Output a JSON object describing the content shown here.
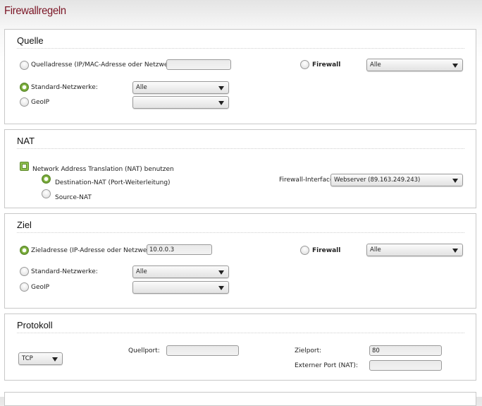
{
  "page": {
    "title": "Firewallregeln"
  },
  "quelle": {
    "title": "Quelle",
    "address_label": "Quelladresse (IP/MAC-Adresse oder Netzwerk):",
    "address_value": "",
    "address_selected": false,
    "firewall_label": "Firewall",
    "firewall_selected": false,
    "firewall_select": "Alle",
    "standard_label": "Standard-Netzwerke:",
    "standard_selected": true,
    "standard_select": "Alle",
    "geoip_label": "GeoIP",
    "geoip_selected": false,
    "geoip_select": ""
  },
  "nat": {
    "title": "NAT",
    "use_nat_label": "Network Address Translation (NAT) benutzen",
    "use_nat_checked": true,
    "dnat_label": "Destination-NAT (Port-Weiterleitung)",
    "dnat_selected": true,
    "snat_label": "Source-NAT",
    "snat_selected": false,
    "interface_label": "Firewall-Interface:",
    "interface_select": "Webserver (89.163.249.243)"
  },
  "ziel": {
    "title": "Ziel",
    "address_label": "Zieladresse (IP-Adresse oder Netzwerk):",
    "address_value": "10.0.0.3",
    "address_selected": true,
    "firewall_label": "Firewall",
    "firewall_selected": false,
    "firewall_select": "Alle",
    "standard_label": "Standard-Netzwerke:",
    "standard_selected": false,
    "standard_select": "Alle",
    "geoip_label": "GeoIP",
    "geoip_selected": false,
    "geoip_select": ""
  },
  "protokoll": {
    "title": "Protokoll",
    "protocol_select": "TCP",
    "source_port_label": "Quellport:",
    "source_port_value": "",
    "dest_port_label": "Zielport:",
    "dest_port_value": "80",
    "external_port_label": "Externer Port (NAT):",
    "external_port_value": ""
  }
}
